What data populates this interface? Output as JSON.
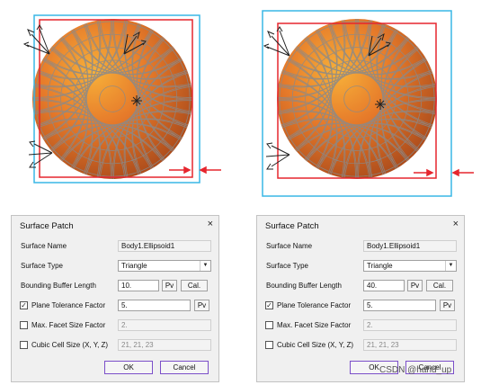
{
  "colors": {
    "sphere_orange": "#e67a2a",
    "mesh_gray": "#8a8a8a",
    "box_cyan": "#39b7e6",
    "box_red": "#e6262e",
    "arrow_red": "#e6262e",
    "button_border": "#7b4fc9"
  },
  "dialogs": [
    {
      "title": "Surface Patch",
      "close_icon": "×",
      "surface_name_label": "Surface Name",
      "surface_name_value": "Body1.Ellipsoid1",
      "surface_type_label": "Surface Type",
      "surface_type_value": "Triangle",
      "bbl_label": "Bounding Buffer Length",
      "bbl_value": "10.",
      "pv_label": "Pv",
      "cal_label": "Cal.",
      "ptf_label": "Plane Tolerance Factor",
      "ptf_checked": true,
      "ptf_value": "5.",
      "mfs_label": "Max. Facet Size Factor",
      "mfs_checked": false,
      "mfs_value": "2.",
      "ccs_label": "Cubic Cell Size (X, Y, Z)",
      "ccs_checked": false,
      "ccs_value": "21, 21, 23",
      "ok_label": "OK",
      "cancel_label": "Cancel"
    },
    {
      "title": "Surface Patch",
      "close_icon": "×",
      "surface_name_label": "Surface Name",
      "surface_name_value": "Body1.Ellipsoid1",
      "surface_type_label": "Surface Type",
      "surface_type_value": "Triangle",
      "bbl_label": "Bounding Buffer Length",
      "bbl_value": "40.",
      "pv_label": "Pv",
      "cal_label": "Cal.",
      "ptf_label": "Plane Tolerance Factor",
      "ptf_checked": true,
      "ptf_value": "5.",
      "mfs_label": "Max. Facet Size Factor",
      "mfs_checked": false,
      "mfs_value": "2.",
      "ccs_label": "Cubic Cell Size (X, Y, Z)",
      "ccs_checked": false,
      "ccs_value": "21, 21, 23",
      "ok_label": "OK",
      "cancel_label": "Cancel"
    }
  ],
  "watermark": "CSDN @hahd_up"
}
